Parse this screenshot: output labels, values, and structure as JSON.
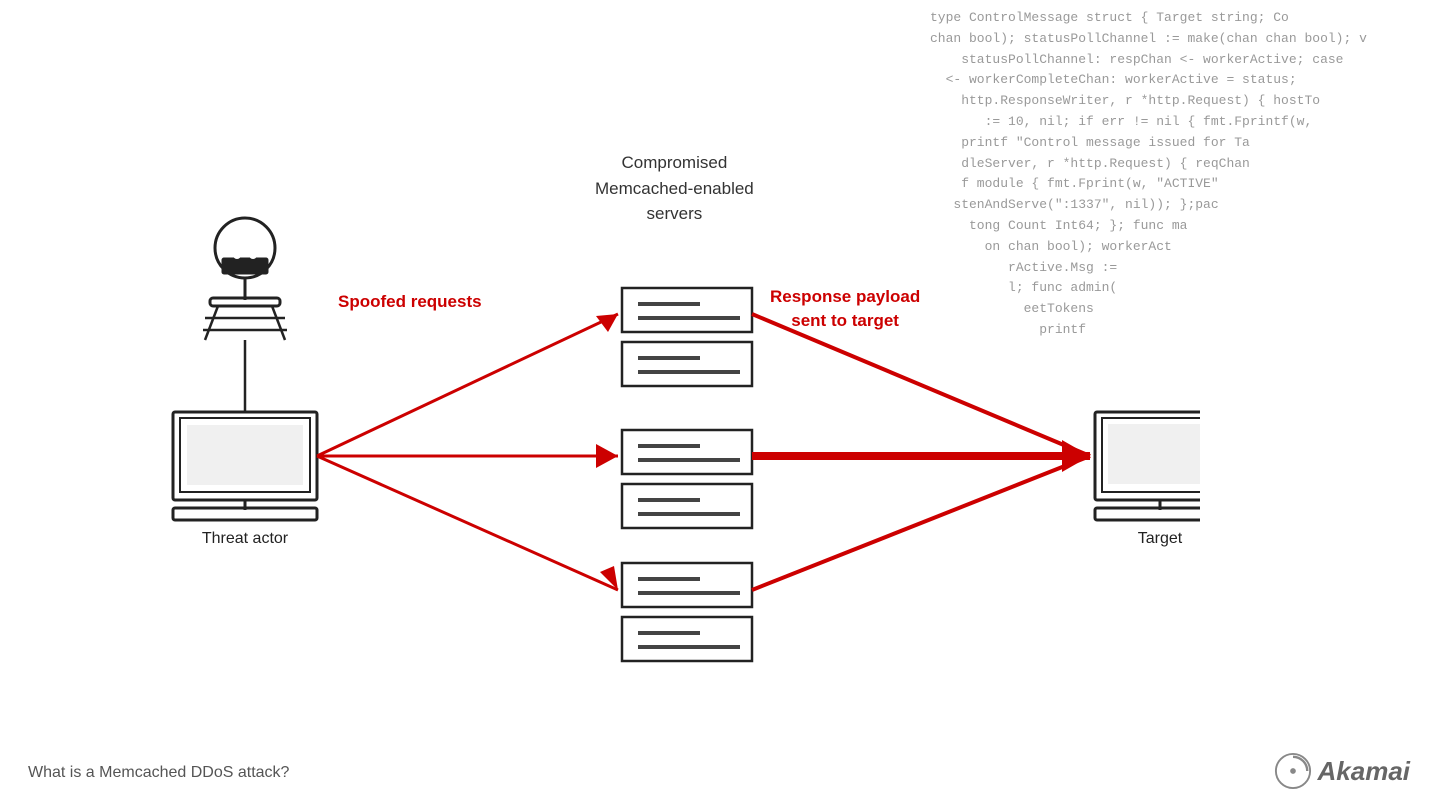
{
  "code_lines": [
    "type ControlMessage struct { Target string; Co",
    "chan bool); statusPollChannel := make(chan chan bool); v",
    "statusPollChannel: respChan <- workerActive; case",
    "<- workerCompleteChan: workerActive = status;",
    "http.ResponseWriter, r *http.Request) { hostTo",
    ":= 10, nil; if err != nil { fmt.Fprintf(w,",
    "printf  \"Control message issued for Ta",
    "dleServer, r *http.Request) { reqChan",
    "f module { fmt.Fprint(w, \"ACTIVE\"",
    "stenAndServe(\":1337\", nil)); };pac",
    "tong Count Int64; }; func ma",
    "on chan bool); workerAct",
    "rActive.Msg :=",
    "1; func admin(",
    "eetTokens",
    "printf"
  ],
  "diagram": {
    "threat_actor_label": "Threat actor",
    "servers_title_line1": "Compromised",
    "servers_title_line2": "Memcached-enabled",
    "servers_title_line3": "servers",
    "spoofed_label_line1": "Spoofed requests",
    "response_label_line1": "Response payload",
    "response_label_line2": "sent to target",
    "target_label": "Target"
  },
  "bottom_label": "What is a Memcached DDoS attack?",
  "akamai_label": "Akamai",
  "colors": {
    "red": "#cc0000",
    "dark": "#222222",
    "gray": "#888888"
  }
}
